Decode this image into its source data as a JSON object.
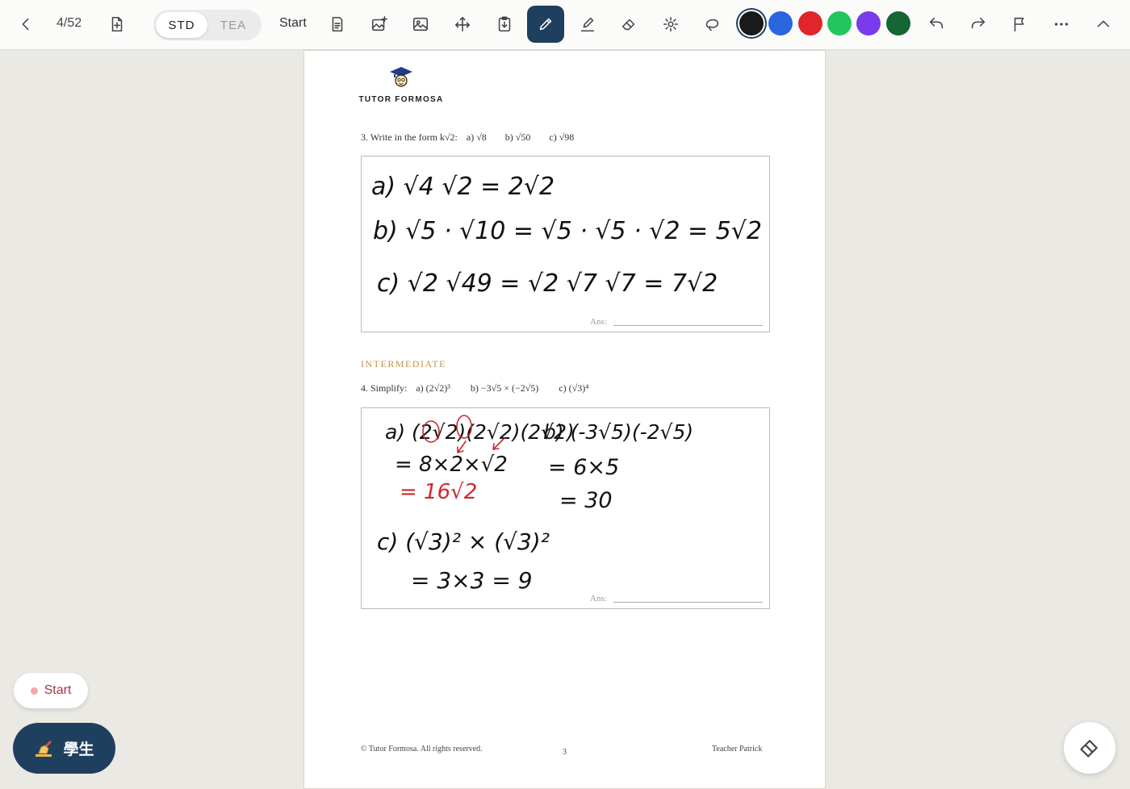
{
  "toolbar": {
    "page_indicator": "4/52",
    "modes": [
      "STD",
      "TEA"
    ],
    "active_mode": "STD",
    "start_label": "Start",
    "colors": [
      "#1a1a1a",
      "#2a66e0",
      "#e0262a",
      "#22c55e",
      "#7c3aed",
      "#166534"
    ],
    "selected_color": "#1a1a1a",
    "active_tool": "pen"
  },
  "worksheet": {
    "logo_text": "TUTOR FORMOSA",
    "q3": {
      "number": "3.",
      "prompt": "Write in the form k√2:",
      "parts": [
        "a) √8",
        "b) √50",
        "c) √98"
      ]
    },
    "q3_answers": [
      "a) √4 √2 = 2√2",
      "b) √5 · √10 = √5 · √5 · √2 = 5√2",
      "c) √2 √49 = √2 √7 √7 = 7√2"
    ],
    "section_label": "INTERMEDIATE",
    "q4": {
      "number": "4.",
      "prompt": "Simplify:",
      "parts": [
        "a) (2√2)³",
        "b) −3√5 × (−2√5)",
        "c) (√3)⁴"
      ]
    },
    "q4_answers": {
      "a_line1": "a) (2√2)(2√2)(2√2)",
      "a_line2": "= 8×2×√2",
      "a_line3": "= 16√2",
      "b_line1": "b) (-3√5)(-2√5)",
      "b_line2": "= 6×5",
      "b_line3": "= 30",
      "c_line1": "c) (√3)² × (√3)²",
      "c_line2": "= 3×3 = 9"
    },
    "ans_label": "Ans:",
    "footer_left": "© Tutor Formosa. All rights reserved.",
    "footer_page": "3",
    "footer_right": "Teacher Patrick"
  },
  "floating": {
    "start_label": "Start",
    "student_label": "學生",
    "student_icon": "writing-hand-icon"
  }
}
